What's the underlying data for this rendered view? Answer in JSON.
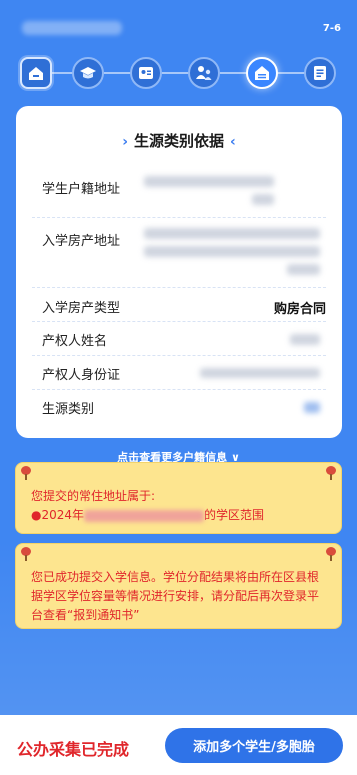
{
  "header": {
    "step_counter": "7-6"
  },
  "steps": [
    {
      "icon": "home-icon"
    },
    {
      "icon": "graduation-cap-icon"
    },
    {
      "icon": "id-card-icon"
    },
    {
      "icon": "parents-icon"
    },
    {
      "icon": "house-certificate-icon"
    },
    {
      "icon": "document-icon"
    }
  ],
  "card": {
    "title": "生源类别依据",
    "rows": {
      "student_address_label": "学生户籍地址",
      "house_address_label": "入学房产地址",
      "house_type_label": "入学房产类型",
      "house_type_value": "购房合同",
      "owner_name_label": "产权人姓名",
      "owner_id_label": "产权人身份证",
      "category_label": "生源类别"
    }
  },
  "more_link": "点击查看更多户籍信息",
  "notice1": {
    "line1": "您提交的常住地址属于:",
    "year_prefix": "●2024年",
    "suffix": "的学区范围"
  },
  "notice2": {
    "text": "您已成功提交入学信息。学位分配结果将由所在区县根据学区学位容量等情况进行安排，请分配后再次登录平台查看“报到通知书”"
  },
  "footer": {
    "status": "公办采集已完成",
    "add_button": "添加多个学生/多胞胎"
  },
  "colors": {
    "background": "#3f86f2",
    "notice_bg": "#fde58f",
    "alert_red": "#e0262b",
    "button_blue": "#2f73e8"
  }
}
